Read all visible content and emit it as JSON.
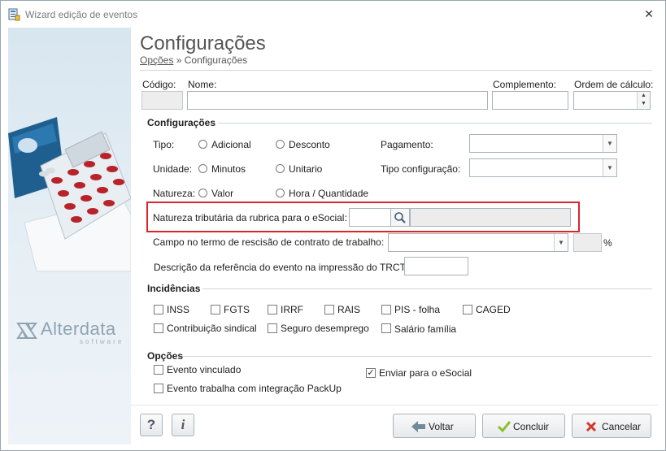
{
  "window": {
    "title": "Wizard edição de eventos",
    "close_glyph": "✕"
  },
  "brand": {
    "name": "Alterdata",
    "tagline": "software"
  },
  "header": {
    "title": "Configurações",
    "breadcrumb_link": "Opções",
    "breadcrumb_sep": "»",
    "breadcrumb_current": "Configurações"
  },
  "fields": {
    "codigo_label": "Código:",
    "codigo_value": "",
    "nome_label": "Nome:",
    "nome_value": "",
    "complemento_label": "Complemento:",
    "complemento_value": "",
    "ordem_label": "Ordem de cálculo:",
    "ordem_value": ""
  },
  "configuracoes": {
    "title": "Configurações",
    "tipo_label": "Tipo:",
    "tipo_opt1": "Adicional",
    "tipo_opt2": "Desconto",
    "unidade_label": "Unidade:",
    "unidade_opt1": "Minutos",
    "unidade_opt2": "Unitario",
    "natureza_label": "Natureza:",
    "natureza_opt1": "Valor",
    "natureza_opt2": "Hora / Quantidade",
    "pagamento_label": "Pagamento:",
    "pagamento_value": "",
    "tipo_config_label": "Tipo configuração:",
    "tipo_config_value": "",
    "natureza_trib_label": "Natureza tributária da rubrica para o eSocial:",
    "natureza_trib_code": "",
    "natureza_trib_desc": "",
    "campo_rescisao_label": "Campo no termo de rescisão de contrato de trabalho:",
    "campo_rescisao_value": "",
    "percent_value": "",
    "percent_sign": "%",
    "descricao_trct_label": "Descrição da referência do evento na impressão do TRCT:",
    "descricao_trct_value": ""
  },
  "incidencias": {
    "title": "Incidências",
    "items": [
      {
        "label": "INSS",
        "checked": false
      },
      {
        "label": "FGTS",
        "checked": false
      },
      {
        "label": "IRRF",
        "checked": false
      },
      {
        "label": "RAIS",
        "checked": false
      },
      {
        "label": "PIS - folha",
        "checked": false
      },
      {
        "label": "CAGED",
        "checked": false
      },
      {
        "label": "Contribuição sindical",
        "checked": false
      },
      {
        "label": "Seguro desemprego",
        "checked": false
      },
      {
        "label": "Salário família",
        "checked": false
      }
    ]
  },
  "opcoes": {
    "title": "Opções",
    "evento_vinculado": "Evento vinculado",
    "enviar_esocial": "Enviar para o eSocial",
    "enviar_esocial_checked": true,
    "integracao_packup": "Evento trabalha com integração PackUp"
  },
  "footer": {
    "help_glyph": "?",
    "info_glyph": "i",
    "voltar": "Voltar",
    "concluir": "Concluir",
    "cancelar": "Cancelar",
    "colors": {
      "voltar_icon": "#6f8a9a",
      "concluir_icon": "#8fbf2a",
      "cancelar_icon": "#d33a2b"
    }
  }
}
